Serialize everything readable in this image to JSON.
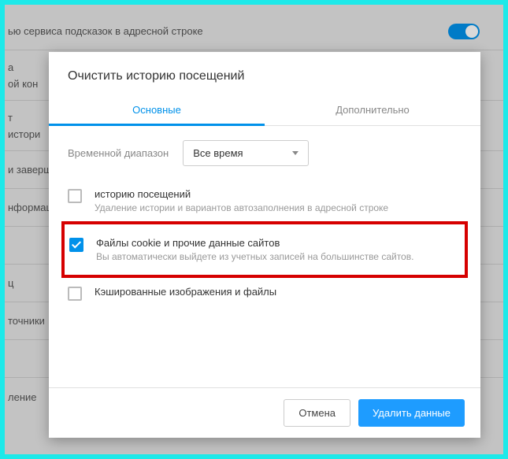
{
  "background": {
    "row1": "ью сервиса подсказок в адресной строке",
    "row2_a": "а",
    "row2_b": "ой кон",
    "row3": "т",
    "row3b": "истори",
    "row4": "и заверш",
    "row5": "нформац",
    "row7": "ц",
    "row8": "точники",
    "row10": "ление"
  },
  "modal": {
    "title": "Очистить историю посещений",
    "tabs": {
      "main": "Основные",
      "extra": "Дополнительно"
    },
    "range_label": "Временной диапазон",
    "range_value": "Все время",
    "options": [
      {
        "title": "историю посещений",
        "sub": "Удаление истории и вариантов автозаполнения в адресной строке",
        "checked": false
      },
      {
        "title": "Файлы cookie и прочие данные сайтов",
        "sub": "Вы автоматически выйдете из учетных записей на большинстве сайтов.",
        "checked": true
      },
      {
        "title": "Кэшированные изображения и файлы",
        "sub": "",
        "checked": false
      }
    ],
    "footer": {
      "cancel": "Отмена",
      "confirm": "Удалить данные"
    }
  }
}
